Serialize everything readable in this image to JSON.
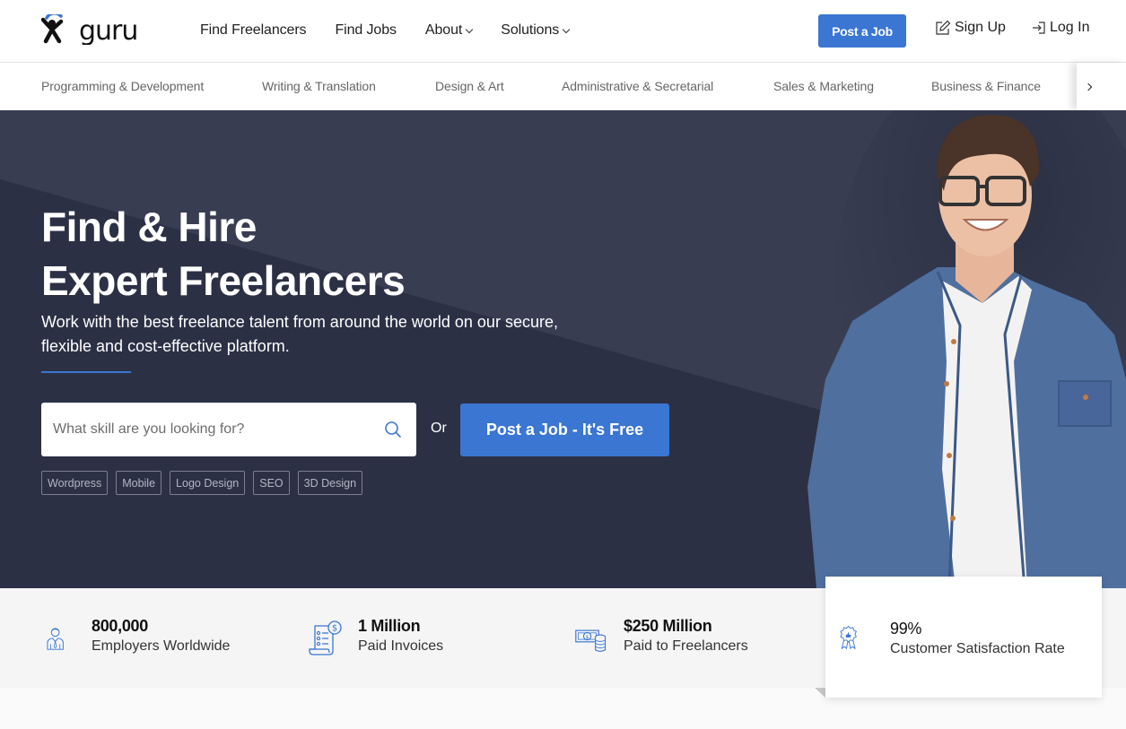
{
  "brand": {
    "name": "guru",
    "accent_color": "#3a76d2",
    "hero_bg_dark": "#2c3045",
    "hero_bg_light": "#383d52"
  },
  "header": {
    "nav": [
      {
        "label": "Find Freelancers",
        "has_dropdown": false
      },
      {
        "label": "Find Jobs",
        "has_dropdown": false
      },
      {
        "label": "About",
        "has_dropdown": true
      },
      {
        "label": "Solutions",
        "has_dropdown": true
      }
    ],
    "post_job_label": "Post a Job",
    "signup_label": "Sign Up",
    "login_label": "Log In"
  },
  "categories": [
    "Programming & Development",
    "Writing & Translation",
    "Design & Art",
    "Administrative & Secretarial",
    "Sales & Marketing",
    "Business & Finance"
  ],
  "hero": {
    "title_line1": "Find & Hire",
    "title_line2": "Expert Freelancers",
    "subtitle": "Work with the best freelance talent from around the world on our secure, flexible and cost-effective platform.",
    "search_placeholder": "What skill are you looking for?",
    "search_value": "",
    "or_label": "Or",
    "cta_label": "Post a Job - It's Free",
    "tags": [
      "Wordpress",
      "Mobile",
      "Logo Design",
      "SEO",
      "3D Design"
    ]
  },
  "stats": [
    {
      "icon": "employer-icon",
      "value": "800,000",
      "label": "Employers Worldwide"
    },
    {
      "icon": "invoice-icon",
      "value": "1 Million",
      "label": "Paid Invoices"
    },
    {
      "icon": "money-icon",
      "value": "$250 Million",
      "label": "Paid to Freelancers"
    },
    {
      "icon": "award-icon",
      "value": "99%",
      "label": "Customer Satisfaction Rate"
    }
  ]
}
